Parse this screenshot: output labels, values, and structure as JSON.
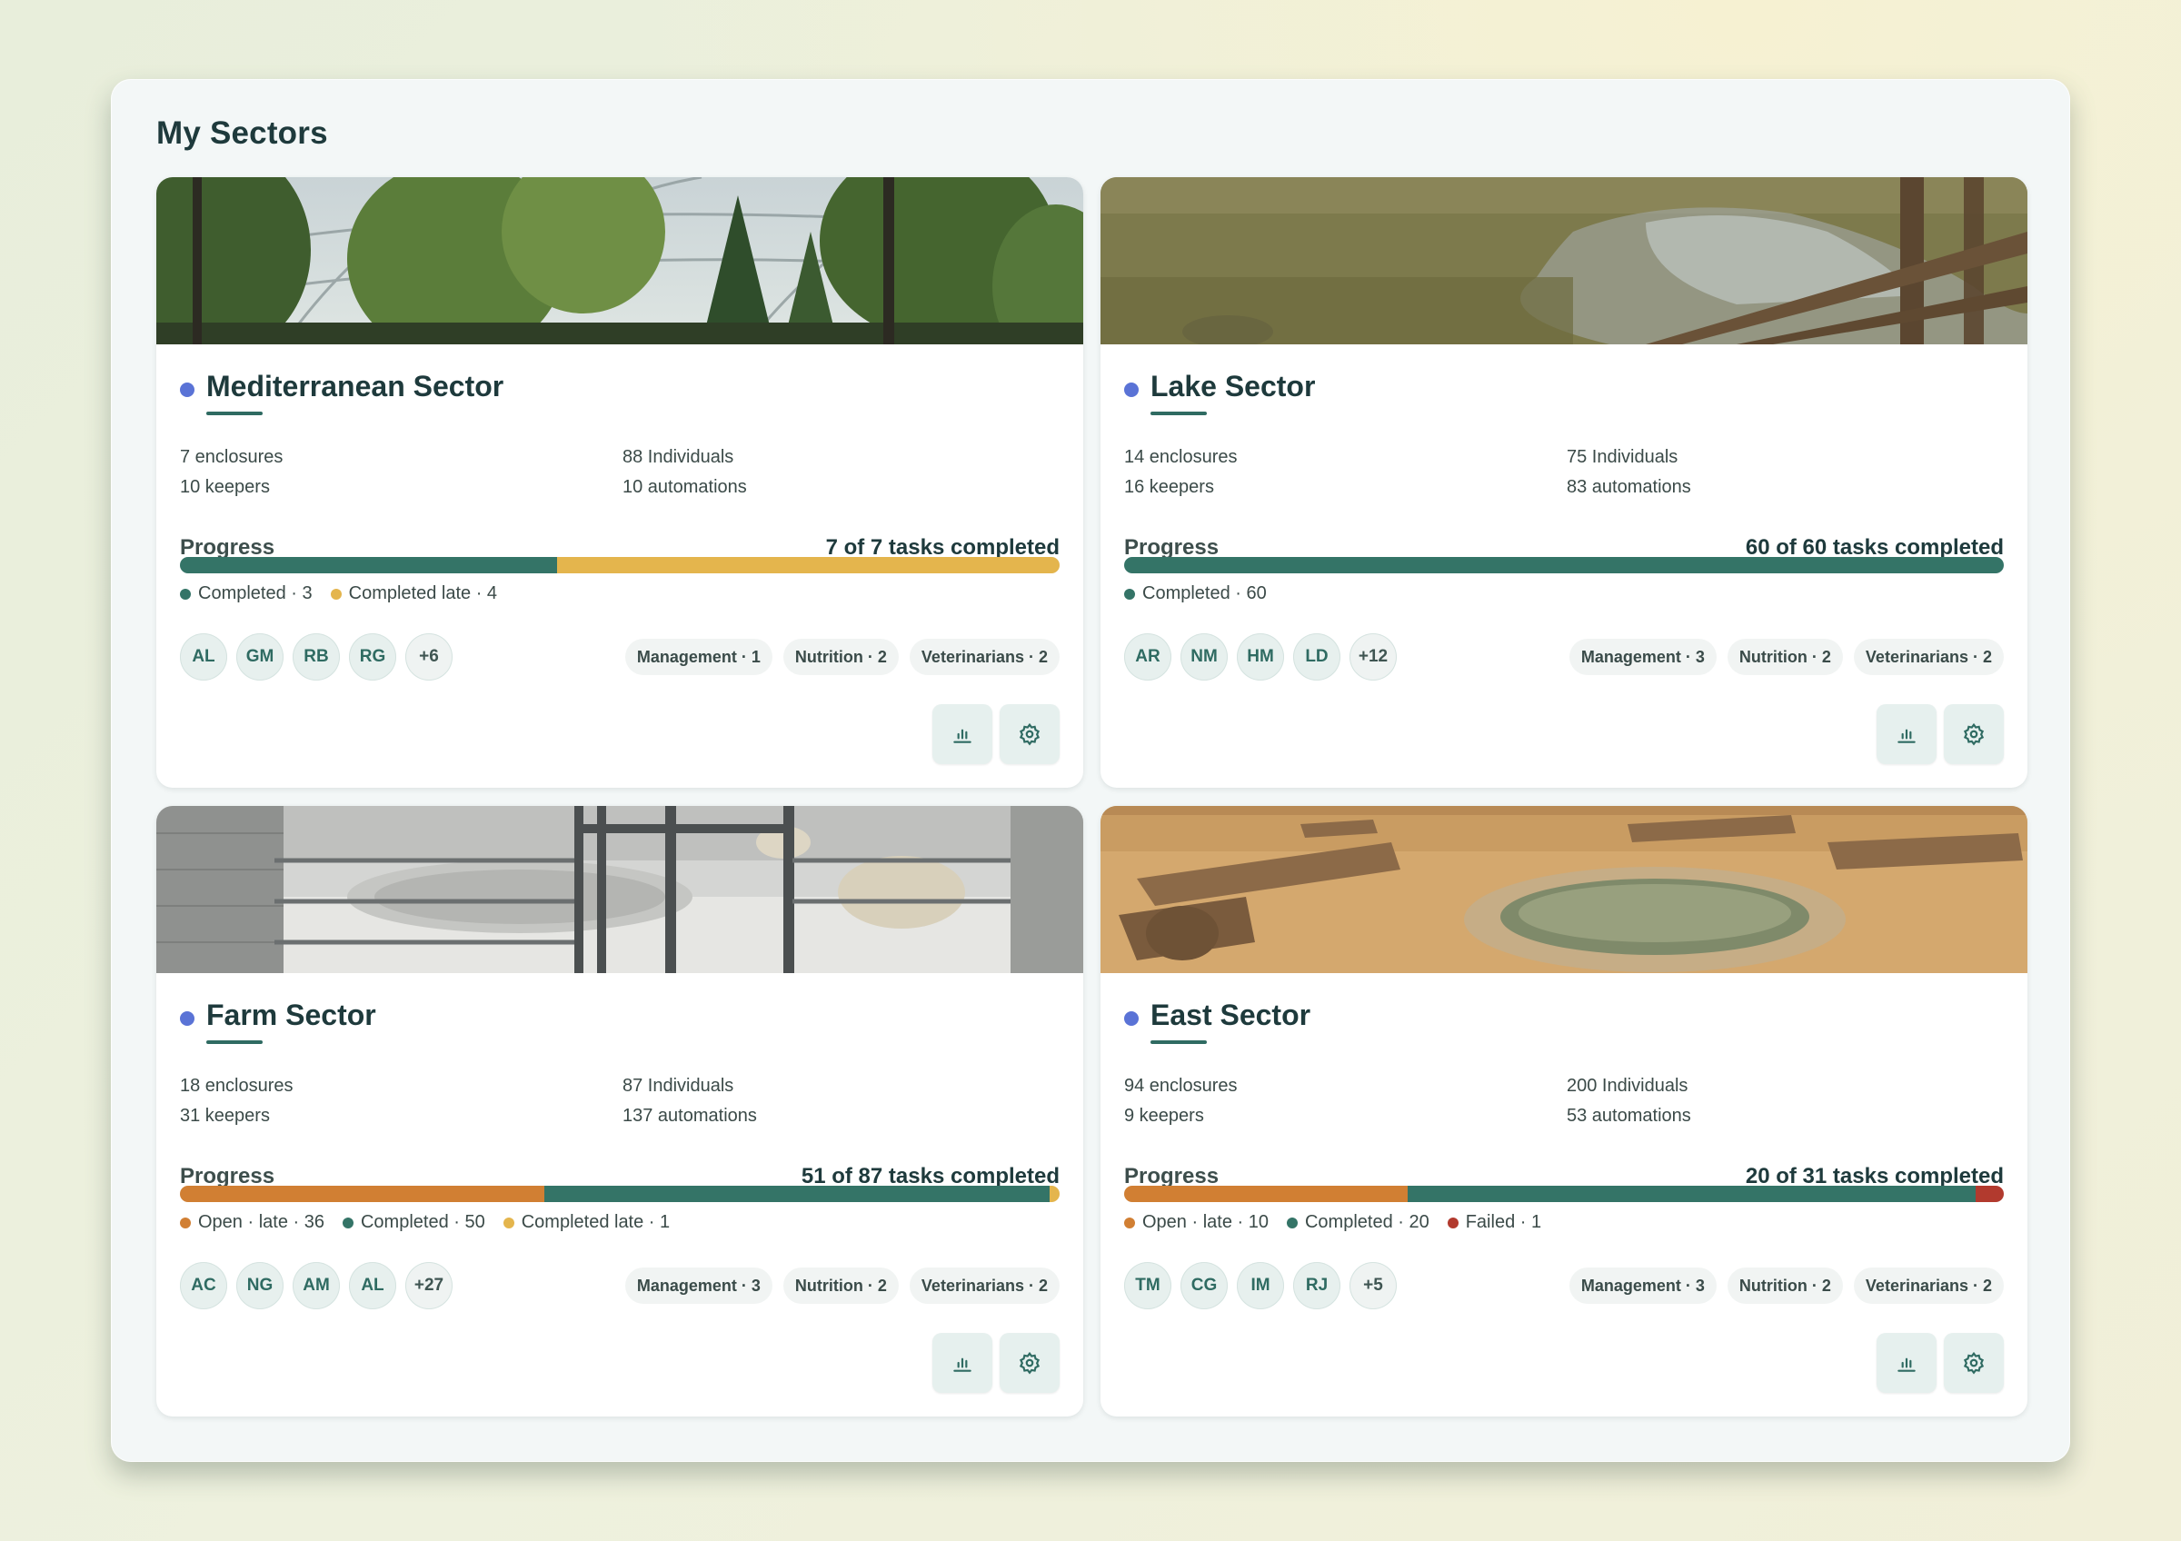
{
  "page": {
    "title": "My Sectors"
  },
  "colors": {
    "accent_dot": "#5a73d6",
    "underline": "#2f6b62",
    "open_late": "#d17f33",
    "completed": "#347467",
    "completed_late": "#e4b54d",
    "failed": "#b23a2e"
  },
  "cards": [
    {
      "name": "Mediterranean Sector",
      "photo": "greenhouse-dome-trees",
      "stats_left": [
        "7 enclosures",
        "10 keepers"
      ],
      "stats_right": [
        "88 Individuals",
        "10 automations"
      ],
      "progress_label": "Progress",
      "progress_count": "7 of 7 tasks completed",
      "segments": [
        {
          "label": "Completed",
          "count": 3,
          "text": "Completed · 3",
          "color": "#347467"
        },
        {
          "label": "Completed late",
          "count": 4,
          "text": "Completed late · 4",
          "color": "#e4b54d"
        }
      ],
      "avatars": [
        "AL",
        "GM",
        "RB",
        "RG"
      ],
      "avatars_more": "+6",
      "chips": [
        "Management · 1",
        "Nutrition · 2",
        "Veterinarians · 2"
      ],
      "actions": [
        "chart-icon",
        "settings-icon"
      ]
    },
    {
      "name": "Lake Sector",
      "photo": "grass-puddle-fence",
      "stats_left": [
        "14 enclosures",
        "16 keepers"
      ],
      "stats_right": [
        "75 Individuals",
        "83 automations"
      ],
      "progress_label": "Progress",
      "progress_count": "60 of 60 tasks completed",
      "segments": [
        {
          "label": "Completed",
          "count": 60,
          "text": "Completed · 60",
          "color": "#347467"
        }
      ],
      "avatars": [
        "AR",
        "NM",
        "HM",
        "LD"
      ],
      "avatars_more": "+12",
      "chips": [
        "Management · 3",
        "Nutrition · 2",
        "Veterinarians · 2"
      ],
      "actions": [
        "chart-icon",
        "settings-icon"
      ]
    },
    {
      "name": "Farm Sector",
      "photo": "concrete-enclosure-gate",
      "stats_left": [
        "18 enclosures",
        "31 keepers"
      ],
      "stats_right": [
        "87 Individuals",
        "137 automations"
      ],
      "progress_label": "Progress",
      "progress_count": "51 of 87 tasks completed",
      "segments": [
        {
          "label": "Open · late",
          "count": 36,
          "text": "Open · late · 36",
          "color": "#d17f33"
        },
        {
          "label": "Completed",
          "count": 50,
          "text": "Completed · 50",
          "color": "#347467"
        },
        {
          "label": "Completed late",
          "count": 1,
          "text": "Completed late · 1",
          "color": "#e4b54d"
        }
      ],
      "avatars": [
        "AC",
        "NG",
        "AM",
        "AL"
      ],
      "avatars_more": "+27",
      "chips": [
        "Management · 3",
        "Nutrition · 2",
        "Veterinarians · 2"
      ],
      "actions": [
        "chart-icon",
        "settings-icon"
      ]
    },
    {
      "name": "East Sector",
      "photo": "sand-logs-pond",
      "stats_left": [
        "94 enclosures",
        "9 keepers"
      ],
      "stats_right": [
        "200 Individuals",
        "53 automations"
      ],
      "progress_label": "Progress",
      "progress_count": "20 of 31 tasks completed",
      "segments": [
        {
          "label": "Open · late",
          "count": 10,
          "text": "Open · late · 10",
          "color": "#d17f33"
        },
        {
          "label": "Completed",
          "count": 20,
          "text": "Completed · 20",
          "color": "#347467"
        },
        {
          "label": "Failed",
          "count": 1,
          "text": "Failed · 1",
          "color": "#b23a2e"
        }
      ],
      "avatars": [
        "TM",
        "CG",
        "IM",
        "RJ"
      ],
      "avatars_more": "+5",
      "chips": [
        "Management · 3",
        "Nutrition · 2",
        "Veterinarians · 2"
      ],
      "actions": [
        "chart-icon",
        "settings-icon"
      ]
    }
  ]
}
